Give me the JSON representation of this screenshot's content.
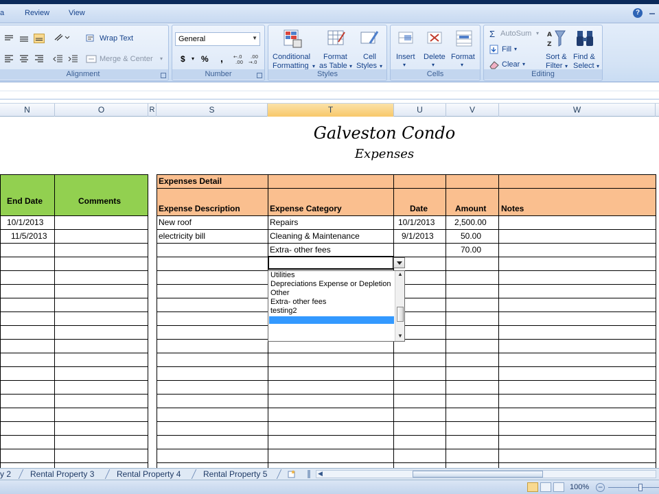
{
  "ribbon": {
    "tabs": [
      "a",
      "Review",
      "View"
    ],
    "alignment": {
      "wrap_text": "Wrap Text",
      "merge_center": "Merge & Center",
      "label": "Alignment"
    },
    "number": {
      "format": "General",
      "currency": "$",
      "percent": "%",
      "comma": ",",
      "inc_decimal": "←.0\n.00",
      "dec_decimal": ".00\n→.0",
      "label": "Number"
    },
    "styles": {
      "conditional": [
        "Conditional",
        "Formatting"
      ],
      "format_table": [
        "Format",
        "as Table"
      ],
      "cell_styles": [
        "Cell",
        "Styles"
      ],
      "label": "Styles"
    },
    "cells": {
      "insert": "Insert",
      "delete": "Delete",
      "format": "Format",
      "label": "Cells"
    },
    "editing": {
      "autosum": "AutoSum",
      "fill": "Fill",
      "clear": "Clear",
      "sort": [
        "Sort &",
        "Filter"
      ],
      "find": [
        "Find &",
        "Select"
      ],
      "label": "Editing"
    },
    "help": "?"
  },
  "columns": [
    "N",
    "O",
    "R",
    "S",
    "T",
    "U",
    "V",
    "W"
  ],
  "sheet": {
    "title": "Galveston Condo",
    "subtitle": "Expenses",
    "left_headers": {
      "end_date": "End Date",
      "comments": "Comments"
    },
    "left_rows": [
      {
        "end_date": "10/1/2013"
      },
      {
        "end_date": "11/5/2013"
      }
    ],
    "section_title": "Expenses Detail",
    "headers": {
      "description": "Expense Description",
      "category": "Expense Category",
      "date": "Date",
      "amount": "Amount",
      "notes": "Notes"
    },
    "rows": [
      {
        "description": "New roof",
        "category": "Repairs",
        "date": "10/1/2013",
        "amount": "2,500.00"
      },
      {
        "description": "electricity bill",
        "category": "Cleaning & Maintenance",
        "date": "9/1/2013",
        "amount": "50.00"
      },
      {
        "description": "",
        "category": "Extra- other fees",
        "date": "",
        "amount": "70.00"
      }
    ]
  },
  "dropdown": {
    "options": [
      "Utilities",
      "Depreciations Expense or Depletion",
      "Other",
      "Extra- other fees",
      "testing2",
      ""
    ],
    "selected_index": 5
  },
  "sheet_tabs": [
    "y 2",
    "Rental Property 3",
    "Rental Property 4",
    "Rental Property 5"
  ],
  "status": {
    "zoom": "100%"
  },
  "colors": {
    "green": "#92d050",
    "orange": "#fabf8f",
    "selection": "#3399ff"
  }
}
